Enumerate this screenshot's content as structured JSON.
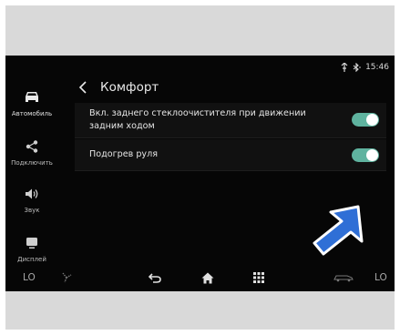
{
  "status": {
    "time": "15:46"
  },
  "sidebar": {
    "items": [
      {
        "label": "Автомобиль",
        "icon": "car-icon",
        "active": true
      },
      {
        "label": "Подключить",
        "icon": "share-icon",
        "active": false
      },
      {
        "label": "Звук",
        "icon": "speaker-icon",
        "active": false
      },
      {
        "label": "Дисплей",
        "icon": "display-icon",
        "active": false
      }
    ]
  },
  "header": {
    "title": "Комфорт"
  },
  "settings": [
    {
      "label": "Вкл. заднего стеклоочистителя при движении задним ходом",
      "enabled": true
    },
    {
      "label": "Подогрев руля",
      "enabled": true
    }
  ],
  "bottombar": {
    "left_temp": "LO",
    "right_temp": "LO"
  },
  "colors": {
    "toggle_on": "#5fb39f",
    "arrow": "#2f6fd6",
    "background": "#060606"
  }
}
